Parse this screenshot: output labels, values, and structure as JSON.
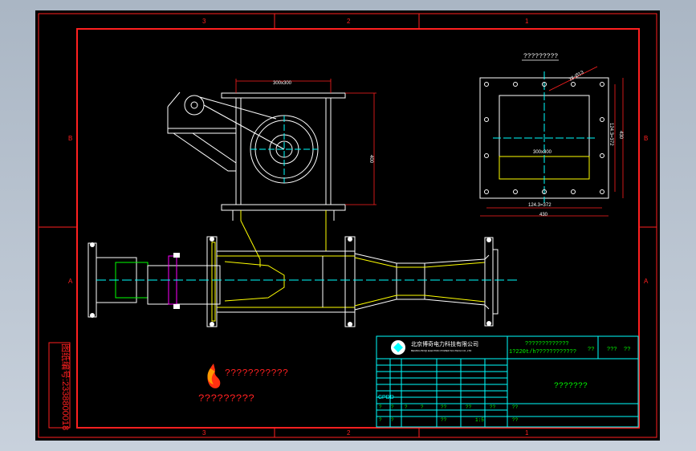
{
  "zone_labels": {
    "top": [
      "3",
      "2",
      "1"
    ],
    "bottom": [
      "3",
      "2",
      "1"
    ],
    "left": [
      "B",
      "A"
    ],
    "right": [
      "B",
      "A"
    ]
  },
  "drawing": {
    "flange_view_title": "?????????",
    "dim_top_opening": "300x300",
    "dim_height": "400",
    "dim_hole_spec": "12-Ø13",
    "dim_inner_opening": "300x300",
    "dim_pitch_vertical": "124.3=372",
    "dim_outer_vertical": "430",
    "dim_pitch_horizontal": "124.3=372",
    "dim_outer_horizontal": "430"
  },
  "side_stamp": "图纸编号:2338800018",
  "logo": {
    "brand_text": "???????????",
    "caption": "?????????"
  },
  "title_block": {
    "company_cn": "北京博奇电力科技有限公司",
    "company_en": "BEIJING BOQI ELECTRIC POWER SCI-TECH CO.,LTD",
    "drawing_title_1": "?????????????",
    "drawing_title_2": "1?220t/h????????????",
    "cell_a": "??",
    "cell_b": "???",
    "cell_c": "??",
    "drawing_name": "???????",
    "cpdd": "CPDD",
    "row_cells": [
      "?",
      "?",
      "?",
      "?",
      "??",
      "??",
      "??",
      "??"
    ],
    "bottom_cells": [
      "?",
      "?",
      "??",
      "1:5",
      "??"
    ]
  },
  "colors": {
    "frame_red": "#ff2020",
    "cyan": "#00ffff",
    "yellow": "#ffff00",
    "white": "#ffffff",
    "magenta": "#ff00ff",
    "green": "#00ff00"
  }
}
